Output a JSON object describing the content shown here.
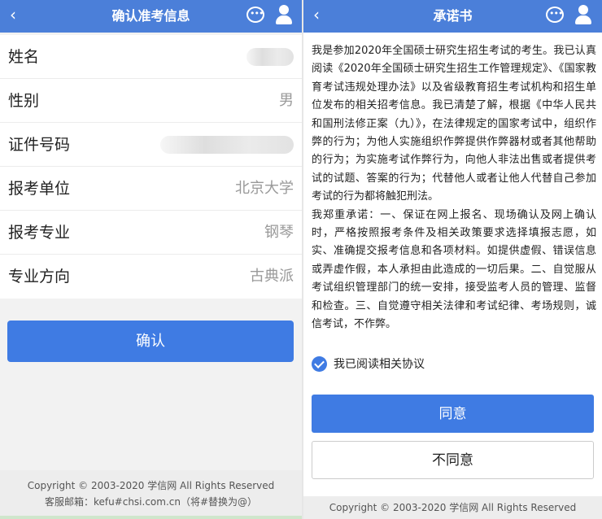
{
  "colors": {
    "accent": "#3f7be3",
    "navbar": "#4b7fd9"
  },
  "left": {
    "navbar": {
      "back": "‹",
      "title": "确认准考信息"
    },
    "fields": [
      {
        "label": "姓名",
        "value": ""
      },
      {
        "label": "性别",
        "value": "男"
      },
      {
        "label": "证件号码",
        "value": ""
      },
      {
        "label": "报考单位",
        "value": "北京大学"
      },
      {
        "label": "报考专业",
        "value": "钢琴"
      },
      {
        "label": "专业方向",
        "value": "古典派"
      }
    ],
    "confirm_label": "确认",
    "footer": {
      "copyright": "Copyright © 2003-2020 学信网 All Rights Reserved",
      "email": "客服邮箱：kefu#chsi.com.cn（将#替换为@）"
    }
  },
  "right": {
    "navbar": {
      "back": "‹",
      "title": "承诺书"
    },
    "paragraphs": [
      "我是参加2020年全国硕士研究生招生考试的考生。我已认真阅读《2020年全国硕士研究生招生工作管理规定》、《国家教育考试违规处理办法》以及省级教育招生考试机构和招生单位发布的相关招考信息。我已清楚了解，根据《中华人民共和国刑法修正案（九）》，在法律规定的国家考试中，组织作弊的行为；为他人实施组织作弊提供作弊器材或者其他帮助的行为；为实施考试作弊行为，向他人非法出售或者提供考试的试题、答案的行为；代替他人或者让他人代替自己参加考试的行为都将触犯刑法。",
      "我郑重承诺：一、保证在网上报名、现场确认及网上确认时，严格按照报考条件及相关政策要求选择填报志愿，如实、准确提交报考信息和各项材料。如提供虚假、错误信息或弄虚作假，本人承担由此造成的一切后果。二、自觉服从考试组织管理部门的统一安排，接受监考人员的管理、监督和检查。三、自觉遵守相关法律和考试纪律、考场规则，诚信考试，不作弊。"
    ],
    "agree_checkbox_label": "我已阅读相关协议",
    "agree_label": "同意",
    "disagree_label": "不同意",
    "footer": {
      "copyright": "Copyright © 2003-2020 学信网 All Rights Reserved"
    }
  },
  "icons": {
    "chat": "chat-bubble-icon",
    "user": "user-icon",
    "back": "chevron-left-icon",
    "check": "check-circle-icon"
  }
}
